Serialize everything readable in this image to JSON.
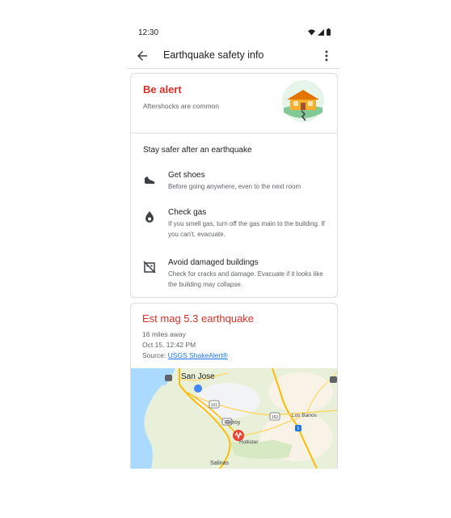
{
  "status_bar": {
    "time": "12:30"
  },
  "app_bar": {
    "title": "Earthquake safety info"
  },
  "alert_card": {
    "title": "Be alert",
    "subtitle": "Aftershocks are common",
    "section_title": "Stay safer after an earthquake",
    "items": [
      {
        "icon": "shoe-icon",
        "title": "Get shoes",
        "description": "Before going anywhere, even to the next room"
      },
      {
        "icon": "gas-flame-icon",
        "title": "Check gas",
        "description": "If you smell gas, turn off the gas main to the building. If you can't, evacuate."
      },
      {
        "icon": "damaged-building-icon",
        "title": "Avoid damaged buildings",
        "description": "Check for cracks and damage. Evacuate if it looks like the building may collapse."
      }
    ]
  },
  "earthquake_card": {
    "title": "Est mag 5.3 earthquake",
    "distance": "16 miles away",
    "datetime": "Oct 15, 12:42 PM",
    "source_prefix": "Source: ",
    "source_link": "USGS ShakeAlert®",
    "map_labels": {
      "san_jose": "San Jose",
      "los_banos": "Los Banos",
      "gilroy": "Gilroy",
      "hollister": "Hollister",
      "salinas": "Salinas"
    },
    "highway_shields": {
      "hwy_101": "101",
      "hwy_5": "5",
      "hwy_152": "152",
      "hwy_156": "156"
    }
  },
  "colors": {
    "alert_red": "#d93025",
    "link_blue": "#1a73e8",
    "epicenter": "#ea4335"
  }
}
